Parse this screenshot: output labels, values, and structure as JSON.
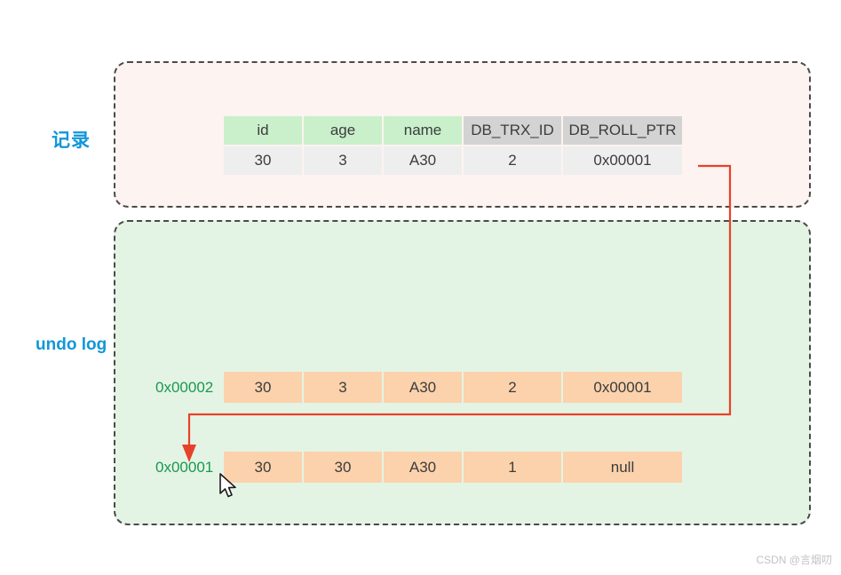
{
  "background": "#ffffff",
  "colors": {
    "label_blue": "#1296db",
    "pointer_green": "#1a9850",
    "arrow_red": "#e8412a",
    "record_box_bg": "#fdf3f0",
    "undolog_box_bg": "#e4f4e4",
    "header_green": "#c9f0cb",
    "header_gray": "#d3d3d3",
    "record_cell_gray": "#eeeeee",
    "undo_cell_orange": "#fbd2ab",
    "dashed_border": "#4a4a4a"
  },
  "labels": {
    "record": "记录",
    "undo_log": "undo log"
  },
  "record": {
    "columns": [
      {
        "label": "id",
        "style": "green",
        "width": "narrow"
      },
      {
        "label": "age",
        "style": "green",
        "width": "narrow"
      },
      {
        "label": "name",
        "style": "green",
        "width": "narrow"
      },
      {
        "label": "DB_TRX_ID",
        "style": "gray",
        "width": "wide"
      },
      {
        "label": "DB_ROLL_PTR",
        "style": "gray",
        "width": "widest"
      }
    ],
    "row": {
      "id": "30",
      "age": "3",
      "name": "A30",
      "db_trx_id": "2",
      "db_roll_ptr": "0x00001"
    }
  },
  "undo_log": {
    "rows": [
      {
        "pointer": "0x00002",
        "id": "30",
        "age": "3",
        "name": "A30",
        "db_trx_id": "2",
        "db_roll_ptr": "0x00001"
      },
      {
        "pointer": "0x00001",
        "id": "30",
        "age": "30",
        "name": "A30",
        "db_trx_id": "1",
        "db_roll_ptr": "null"
      }
    ]
  },
  "connector": {
    "description": "red-pointer-arrow-from-record-db-roll-ptr-to-undo-log-0x00001"
  },
  "watermark": "CSDN @言烟叨"
}
